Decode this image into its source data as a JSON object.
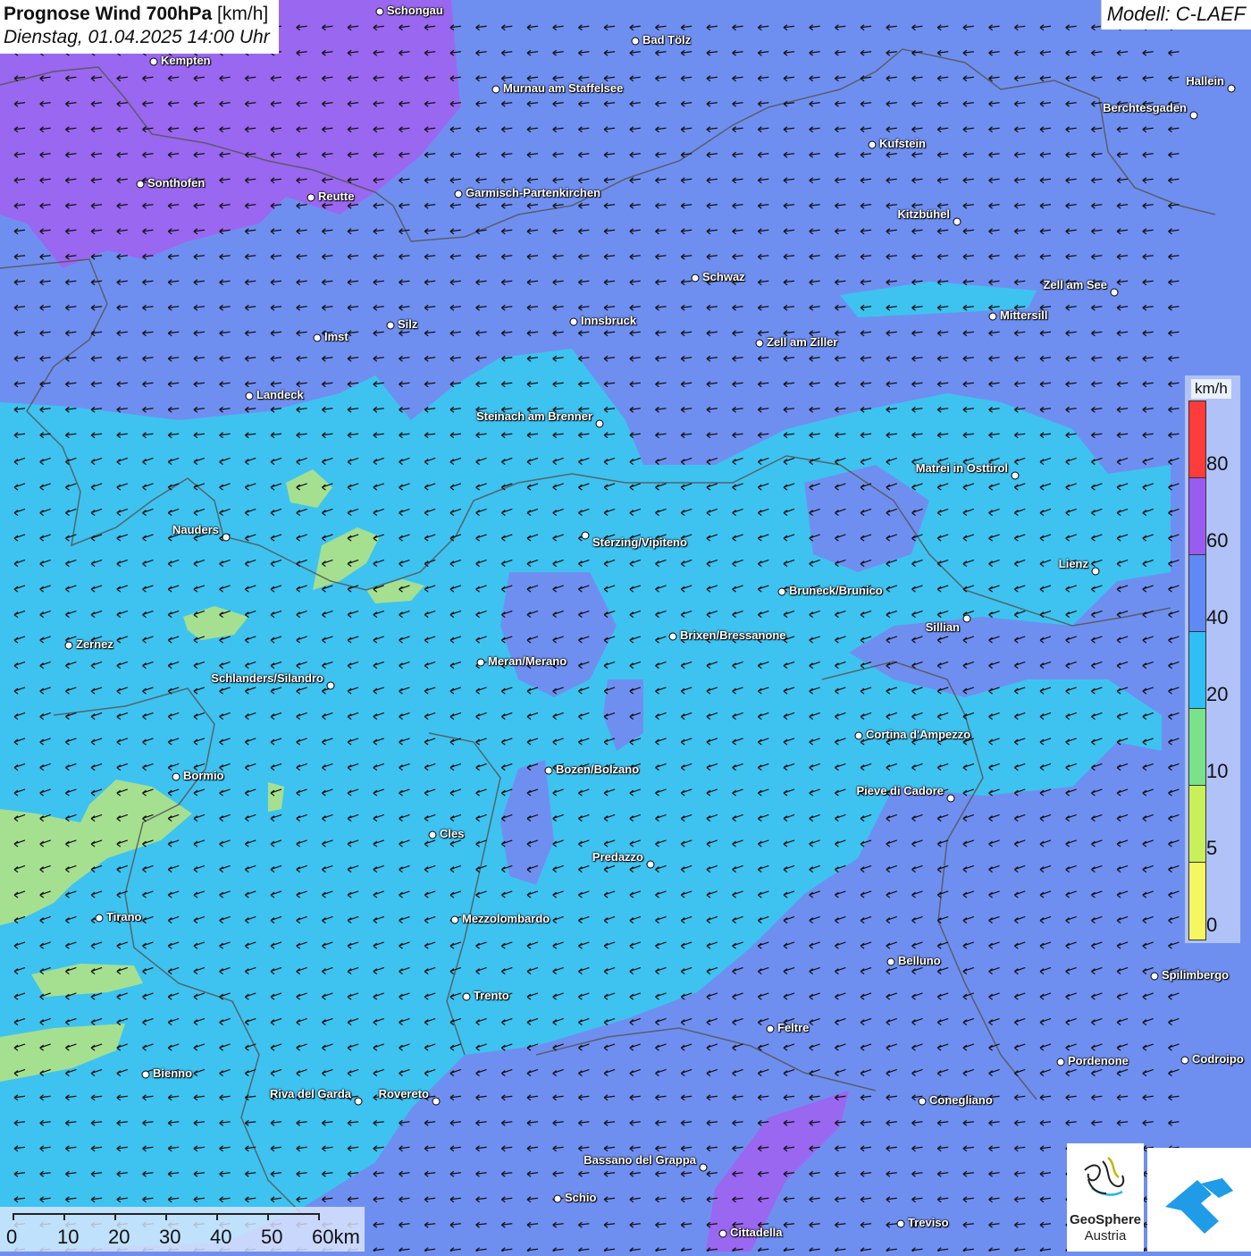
{
  "title": {
    "main": "Prognose Wind 700hPa",
    "unit": "[km/h]",
    "date": "Dienstag, 01.04.2025 14:00 Uhr"
  },
  "model": "Modell: C-LAEF",
  "colors": {
    "bg_40_60": "#6f8ff0",
    "band_20_40": "#3ec3f0",
    "band_10_20": "#9ae39a",
    "band_60_80": "#9a67f0",
    "arrow": "#111111",
    "border": "#555555"
  },
  "cities": [
    {
      "name": "Schongau"
    },
    {
      "name": "Bad Tölz"
    },
    {
      "name": "Kempten"
    },
    {
      "name": "Murnau am Staffelsee"
    },
    {
      "name": "Hallein"
    },
    {
      "name": "Berchtesgaden"
    },
    {
      "name": "Kufstein"
    },
    {
      "name": "Sonthofen"
    },
    {
      "name": "Reutte"
    },
    {
      "name": "Garmisch-Partenkirchen"
    },
    {
      "name": "Kitzbühel"
    },
    {
      "name": "Schwaz"
    },
    {
      "name": "Zell am See"
    },
    {
      "name": "Mittersill"
    },
    {
      "name": "Innsbruck"
    },
    {
      "name": "Silz"
    },
    {
      "name": "Imst"
    },
    {
      "name": "Zell am Ziller"
    },
    {
      "name": "Landeck"
    },
    {
      "name": "Steinach am Brenner"
    },
    {
      "name": "Matrei in Osttirol"
    },
    {
      "name": "Nauders"
    },
    {
      "name": "Sterzing/Vipiteno"
    },
    {
      "name": "Lienz"
    },
    {
      "name": "Bruneck/Brunico"
    },
    {
      "name": "Sillian"
    },
    {
      "name": "Zernez"
    },
    {
      "name": "Brixen/Bressanone"
    },
    {
      "name": "Meran/Merano"
    },
    {
      "name": "Schlanders/Silandro"
    },
    {
      "name": "Cortina d'Ampezzo"
    },
    {
      "name": "Bozen/Bolzano"
    },
    {
      "name": "Bormio"
    },
    {
      "name": "Pieve di Cadore"
    },
    {
      "name": "Cles"
    },
    {
      "name": "Predazzo"
    },
    {
      "name": "Tirano"
    },
    {
      "name": "Mezzolombardo"
    },
    {
      "name": "Belluno"
    },
    {
      "name": "Spilimbergo"
    },
    {
      "name": "Trento"
    },
    {
      "name": "Feltre"
    },
    {
      "name": "Pordenone"
    },
    {
      "name": "Codroipo"
    },
    {
      "name": "Bienno"
    },
    {
      "name": "Riva del Garda"
    },
    {
      "name": "Rovereto"
    },
    {
      "name": "Conegliano"
    },
    {
      "name": "Bassano del Grappa"
    },
    {
      "name": "Schio"
    },
    {
      "name": "Treviso"
    },
    {
      "name": "Cittadella"
    }
  ],
  "legend": {
    "unit": "km/h",
    "labels": [
      "80",
      "60",
      "40",
      "20",
      "10",
      "5",
      "0"
    ],
    "colors": [
      "#ff3b3b",
      "#9a5cf0",
      "#5f8af5",
      "#2ec0f5",
      "#79e28a",
      "#c8f05a",
      "#f6f660"
    ]
  },
  "scale": {
    "labels": [
      "0",
      "10",
      "20",
      "30",
      "40",
      "50",
      "60km"
    ]
  },
  "logos": {
    "geosphere_line1": "GeoSphere",
    "geosphere_line2": "Austria"
  }
}
